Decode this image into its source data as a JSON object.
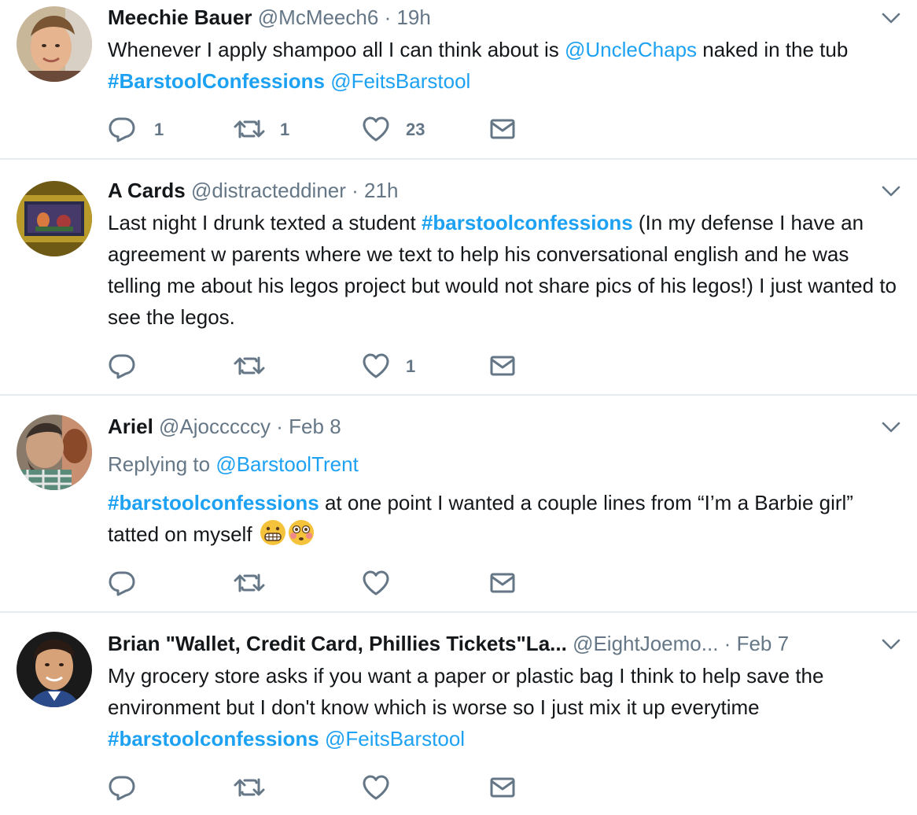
{
  "colors": {
    "link": "#1da1f2",
    "muted": "#657786",
    "text": "#14171a",
    "divider": "#e6ecf0"
  },
  "tweets": [
    {
      "name": "Meechie Bauer",
      "handle": "@McMeech6",
      "sep": "·",
      "time": "19h",
      "body": {
        "t1": "Whenever I apply shampoo all I can think about is ",
        "m1": "@UncleChaps",
        "t2": " naked in the tub ",
        "h1": "#BarstoolConfessions",
        "t3": " ",
        "m2": "@FeitsBarstool"
      },
      "counts": {
        "replies": "1",
        "retweets": "1",
        "likes": "23"
      }
    },
    {
      "name": "A Cards",
      "handle": "@distracteddiner",
      "sep": "·",
      "time": "21h",
      "body": {
        "t1": "Last night I drunk texted a student ",
        "h1": "#barstoolconfessions",
        "t2": " (In my defense I have an agreement w parents where we text to help his conversational english and he was telling me about his legos project but would not share pics of his legos!) I just wanted to see the legos."
      },
      "counts": {
        "replies": "",
        "retweets": "",
        "likes": "1"
      }
    },
    {
      "name": "Ariel",
      "handle": "@Ajocccccy",
      "sep": "·",
      "time": "Feb 8",
      "reply_prefix": "Replying to ",
      "reply_handle": "@BarstoolTrent",
      "body": {
        "h1": "#barstoolconfessions",
        "t1": " at one point I wanted a couple lines from “I’m a Barbie girl” tatted on myself "
      },
      "emojis": [
        "grimacing-face-emoji",
        "flushed-face-emoji"
      ],
      "counts": {
        "replies": "",
        "retweets": "",
        "likes": ""
      }
    },
    {
      "name": "Brian \"Wallet, Credit Card, Phillies Tickets\"La...",
      "handle": "@EightJoemo...",
      "sep": "·",
      "time": "Feb 7",
      "body": {
        "t1": "My grocery store asks if you want a paper or plastic bag I think to help save the environment but I don't know which is worse so I just mix it up everytime ",
        "h1": "#barstoolconfessions",
        "t2": " ",
        "m1": "@FeitsBarstool"
      },
      "counts": {
        "replies": "",
        "retweets": "",
        "likes": ""
      }
    }
  ]
}
